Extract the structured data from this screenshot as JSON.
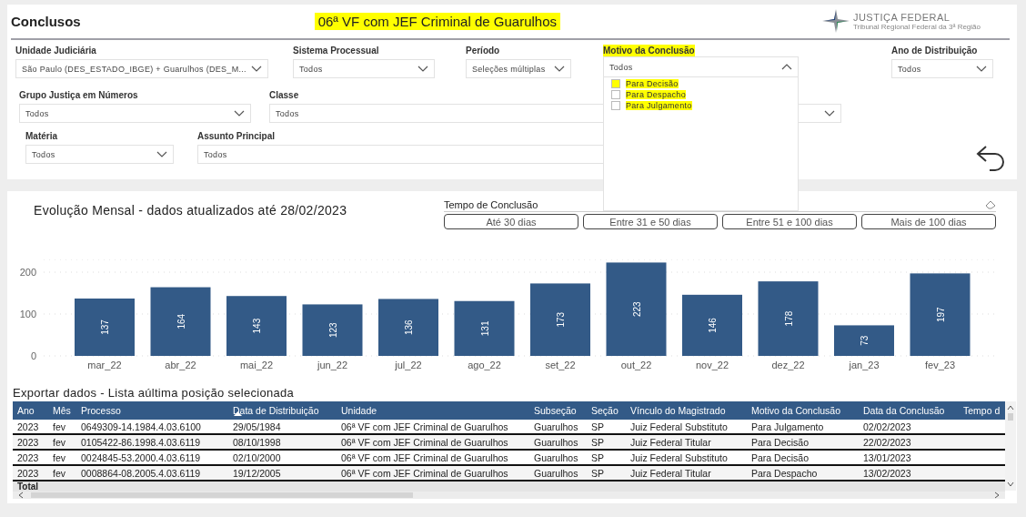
{
  "header": {
    "title": "Conclusos",
    "unit_title": {
      "text": "06ª VF com JEF Criminal de Guarulhos",
      "highlighted": true
    },
    "logo": {
      "name": "JUSTIÇA FEDERAL",
      "subtitle": "Tribunal Regional Federal da 3ª Região"
    }
  },
  "filter_rows": [
    [
      {
        "label": "Unidade Judiciária",
        "value": "São Paulo (DES_ESTADO_IBGE) + Guarulhos (DES_M...",
        "highlighted": false,
        "expanded": false,
        "chevron": true
      },
      {
        "label": "Sistema Processual",
        "value": "Todos",
        "highlighted": false,
        "expanded": false,
        "chevron": true
      },
      {
        "label": "Período",
        "value": "Seleções múltiplas",
        "highlighted": false,
        "expanded": false,
        "chevron": true
      },
      {
        "label": "Motivo da Conclusão",
        "value": "Todos",
        "highlighted": true,
        "expanded": true,
        "chevron": true,
        "options": [
          {
            "label": "Para Decisão",
            "checked": false,
            "highlighted": true,
            "box_highlighted": true
          },
          {
            "label": "Para Despacho",
            "checked": false,
            "highlighted": true,
            "box_highlighted": false
          },
          {
            "label": "Para Julgamento",
            "checked": false,
            "highlighted": true,
            "box_highlighted": false
          }
        ]
      },
      {
        "label": "Ano de Distribuição",
        "value": "Todos",
        "highlighted": false,
        "expanded": false,
        "chevron": true
      }
    ],
    [
      {
        "label": "Grupo Justiça em Números",
        "value": "Todos",
        "highlighted": false,
        "expanded": false,
        "chevron": true
      },
      {
        "label": "Classe",
        "value": "Todos",
        "highlighted": false,
        "expanded": false,
        "chevron": true
      }
    ],
    [
      {
        "label": "Matéria",
        "value": "Todos",
        "highlighted": false,
        "expanded": false,
        "chevron": true
      },
      {
        "label": "Assunto Principal",
        "value": "Todos",
        "highlighted": false,
        "expanded": false,
        "chevron": false
      }
    ]
  ],
  "chart_section": {
    "title": "Evolução Mensal - dados atualizados até 28/02/2023",
    "tempo_slicer": {
      "label": "Tempo de Conclusão",
      "options": [
        {
          "label": "Até 30 dias",
          "selected": false
        },
        {
          "label": "Entre 31 e 50 dias",
          "selected": false
        },
        {
          "label": "Entre 51 e 100 dias",
          "selected": false
        },
        {
          "label": "Mais de 100 dias",
          "selected": false
        }
      ]
    },
    "chart_data": {
      "type": "bar",
      "categories": [
        "mar_22",
        "abr_22",
        "mai_22",
        "jun_22",
        "jul_22",
        "ago_22",
        "set_22",
        "out_22",
        "nov_22",
        "dez_22",
        "jan_23",
        "fev_23"
      ],
      "values": [
        137,
        164,
        143,
        123,
        136,
        131,
        173,
        223,
        146,
        178,
        73,
        197
      ],
      "ylim": [
        0,
        230
      ],
      "yticks": [
        0,
        100,
        200
      ],
      "data_labels": true
    }
  },
  "table": {
    "title": "Exportar dados - Lista aúltima posição selecionada",
    "columns": [
      {
        "label": "Ano",
        "sorted": false
      },
      {
        "label": "Mês",
        "sorted": false
      },
      {
        "label": "Processo",
        "sorted": false
      },
      {
        "label": "Data de Distribuição",
        "sorted": true
      },
      {
        "label": "Unidade",
        "sorted": false
      },
      {
        "label": "Subseção",
        "sorted": false
      },
      {
        "label": "Seção",
        "sorted": false
      },
      {
        "label": "Vínculo do Magistrado",
        "sorted": false
      },
      {
        "label": "Motivo da Conclusão",
        "sorted": false
      },
      {
        "label": "Data da Conclusão",
        "sorted": false
      },
      {
        "label": "Tempo d",
        "sorted": false
      }
    ],
    "rows": [
      [
        "2023",
        "fev",
        "0649309-14.1984.4.03.6100",
        "29/05/1984",
        "06ª VF com JEF Criminal de Guarulhos",
        "Guarulhos",
        "SP",
        "Juiz Federal Substituto",
        "Para Julgamento",
        "02/02/2023"
      ],
      [
        "2023",
        "fev",
        "0105422-86.1998.4.03.6119",
        "08/10/1998",
        "06ª VF com JEF Criminal de Guarulhos",
        "Guarulhos",
        "SP",
        "Juiz Federal Titular",
        "Para Decisão",
        "22/02/2023"
      ],
      [
        "2023",
        "fev",
        "0024845-53.2000.4.03.6119",
        "02/10/2000",
        "06ª VF com JEF Criminal de Guarulhos",
        "Guarulhos",
        "SP",
        "Juiz Federal Substituto",
        "Para Decisão",
        "13/01/2023"
      ],
      [
        "2023",
        "fev",
        "0008864-08.2005.4.03.6119",
        "19/12/2005",
        "06ª VF com JEF Criminal de Guarulhos",
        "Guarulhos",
        "SP",
        "Juiz Federal Titular",
        "Para Despacho",
        "13/02/2023"
      ]
    ],
    "total_label": "Total"
  }
}
